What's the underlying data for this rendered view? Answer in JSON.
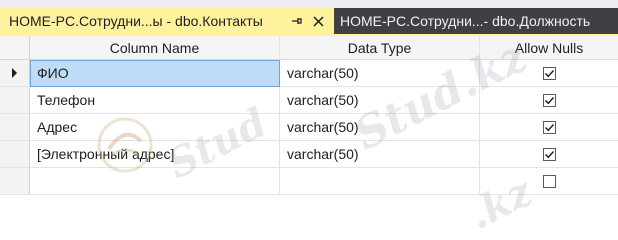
{
  "tabs": [
    {
      "title": "HOME-PC.Сотрудни...ы - dbo.Контакты",
      "active": true
    },
    {
      "title": "HOME-PC.Сотрудни...- dbo.Должность",
      "active": false
    }
  ],
  "tab_icons": {
    "pin": "pin-icon",
    "close": "close-icon"
  },
  "grid": {
    "columns": [
      "Column Name",
      "Data Type",
      "Allow Nulls"
    ],
    "rows": [
      {
        "name": "ФИО",
        "type": "varchar(50)",
        "allow_nulls": true
      },
      {
        "name": "Телефон",
        "type": "varchar(50)",
        "allow_nulls": true
      },
      {
        "name": "Адрес",
        "type": "varchar(50)",
        "allow_nulls": true
      },
      {
        "name": "[Электронный адрес]",
        "type": "varchar(50)",
        "allow_nulls": true
      },
      {
        "name": "",
        "type": "",
        "allow_nulls": false
      }
    ]
  },
  "watermark": {
    "text": "Stud.kz",
    "text_short": "Stud",
    "text_tail": ".kz"
  },
  "colors": {
    "active_tab": "#fff29d",
    "inactive_tab": "#3f3f46",
    "selection": "#bfdcf6"
  }
}
